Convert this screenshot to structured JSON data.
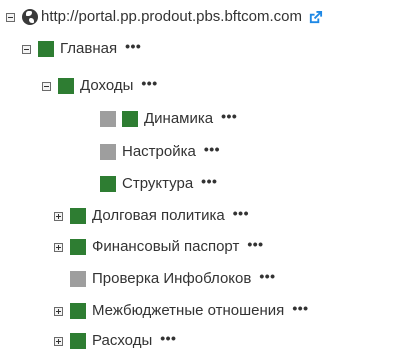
{
  "root": {
    "url": "http://portal.pp.prodout.pbs.bftcom.com"
  },
  "tree": {
    "items": [
      {
        "label": "Главная",
        "more": "•••"
      },
      {
        "label": "Доходы",
        "more": "•••"
      },
      {
        "label": "Динамика",
        "more": "•••"
      },
      {
        "label": "Настройка",
        "more": "•••"
      },
      {
        "label": "Структура",
        "more": "•••"
      },
      {
        "label": "Долговая политика",
        "more": "•••"
      },
      {
        "label": "Финансовый паспорт",
        "more": "•••"
      },
      {
        "label": "Проверка Инфоблоков",
        "more": "•••"
      },
      {
        "label": "Межбюджетные отношения",
        "more": "•••"
      },
      {
        "label": "Расходы",
        "more": "•••"
      }
    ]
  },
  "colors": {
    "green_square": "#2e7d32",
    "gray_square": "#9e9e9e",
    "link_icon": "#1e88e5"
  },
  "icons": {
    "root_toggle": "collapse-icon",
    "root": "globe-icon",
    "external": "external-link-icon"
  }
}
